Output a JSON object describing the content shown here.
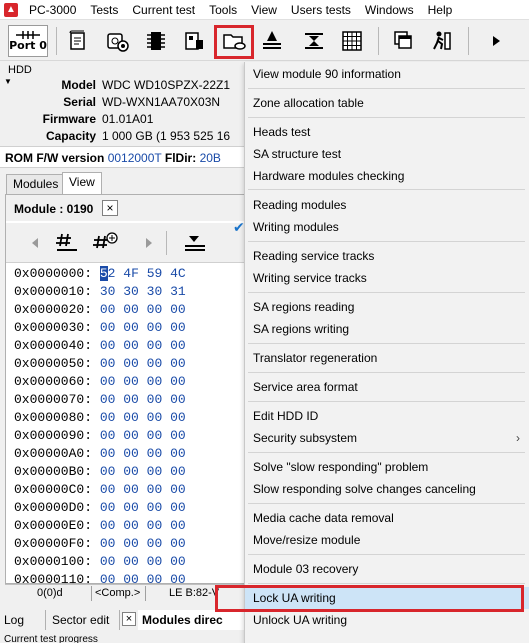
{
  "menubar": {
    "app_name": "PC-3000",
    "items": [
      "Tests",
      "Current test",
      "Tools",
      "View",
      "Users tests",
      "Windows",
      "Help"
    ]
  },
  "toolbar": {
    "port_label": "Port 0"
  },
  "hdd": {
    "section_label": "HDD",
    "fields": [
      {
        "key": "Model",
        "value": "WDC WD10SPZX-22Z1"
      },
      {
        "key": "Serial",
        "value": "WD-WXN1AA70X03N"
      },
      {
        "key": "Firmware",
        "value": "01.01A01"
      },
      {
        "key": "Capacity",
        "value": "1 000 GB (1 953 525 16"
      }
    ]
  },
  "rom": {
    "label": "ROM F/W version",
    "value": "0012000T",
    "fldir_label": "FlDir:",
    "fldir_value": "20B"
  },
  "tabs": [
    "Modules",
    "View"
  ],
  "module": {
    "title": "Module : 0190",
    "close": "×"
  },
  "hex": {
    "rows": [
      {
        "addr": "0x0000000:",
        "bytes": [
          "52",
          "4F",
          "59",
          "4C"
        ]
      },
      {
        "addr": "0x0000010:",
        "bytes": [
          "30",
          "30",
          "30",
          "31"
        ]
      },
      {
        "addr": "0x0000020:",
        "bytes": [
          "00",
          "00",
          "00",
          "00"
        ]
      },
      {
        "addr": "0x0000030:",
        "bytes": [
          "00",
          "00",
          "00",
          "00"
        ]
      },
      {
        "addr": "0x0000040:",
        "bytes": [
          "00",
          "00",
          "00",
          "00"
        ]
      },
      {
        "addr": "0x0000050:",
        "bytes": [
          "00",
          "00",
          "00",
          "00"
        ]
      },
      {
        "addr": "0x0000060:",
        "bytes": [
          "00",
          "00",
          "00",
          "00"
        ]
      },
      {
        "addr": "0x0000070:",
        "bytes": [
          "00",
          "00",
          "00",
          "00"
        ]
      },
      {
        "addr": "0x0000080:",
        "bytes": [
          "00",
          "00",
          "00",
          "00"
        ]
      },
      {
        "addr": "0x0000090:",
        "bytes": [
          "00",
          "00",
          "00",
          "00"
        ]
      },
      {
        "addr": "0x00000A0:",
        "bytes": [
          "00",
          "00",
          "00",
          "00"
        ]
      },
      {
        "addr": "0x00000B0:",
        "bytes": [
          "00",
          "00",
          "00",
          "00"
        ]
      },
      {
        "addr": "0x00000C0:",
        "bytes": [
          "00",
          "00",
          "00",
          "00"
        ]
      },
      {
        "addr": "0x00000D0:",
        "bytes": [
          "00",
          "00",
          "00",
          "00"
        ]
      },
      {
        "addr": "0x00000E0:",
        "bytes": [
          "00",
          "00",
          "00",
          "00"
        ]
      },
      {
        "addr": "0x00000F0:",
        "bytes": [
          "00",
          "00",
          "00",
          "00"
        ]
      },
      {
        "addr": "0x0000100:",
        "bytes": [
          "00",
          "00",
          "00",
          "00"
        ]
      },
      {
        "addr": "0x0000110:",
        "bytes": [
          "00",
          "00",
          "00",
          "00"
        ]
      }
    ]
  },
  "status": {
    "offset": "0(0)d",
    "mode": "<Comp.>",
    "position": "LE B:82-V"
  },
  "bottom_tabs": {
    "log": "Log",
    "sector_edit": "Sector edit",
    "close": "×",
    "modules_dir": "Modules direc"
  },
  "status_text": "Current test progress",
  "dropdown": {
    "items": [
      {
        "label": "View module 90 information"
      },
      {
        "label": "Zone allocation table"
      },
      {
        "label": "Heads test"
      },
      {
        "label": "SA structure test"
      },
      {
        "label": "Hardware modules checking"
      },
      {
        "label": "Reading modules"
      },
      {
        "label": "Writing modules",
        "checked": true
      },
      {
        "label": "Reading service tracks"
      },
      {
        "label": "Writing service tracks"
      },
      {
        "label": "SA regions reading"
      },
      {
        "label": "SA regions writing"
      },
      {
        "label": "Translator regeneration"
      },
      {
        "label": "Service area format"
      },
      {
        "label": "Edit HDD ID"
      },
      {
        "label": "Security subsystem",
        "submenu": true
      },
      {
        "label": "Solve \"slow responding\" problem"
      },
      {
        "label": "Slow responding solve changes canceling"
      },
      {
        "label": "Media cache data removal"
      },
      {
        "label": "Move/resize module"
      },
      {
        "label": "Module 03 recovery"
      },
      {
        "label": "Lock UA writing",
        "highlighted": true
      },
      {
        "label": "Unlock UA writing"
      }
    ],
    "check_mark": "✔",
    "submenu_arrow": "›"
  },
  "colors": {
    "accent_red": "#d8262c",
    "hex_blue": "#1a4ba8",
    "highlight": "#cde4f7"
  }
}
